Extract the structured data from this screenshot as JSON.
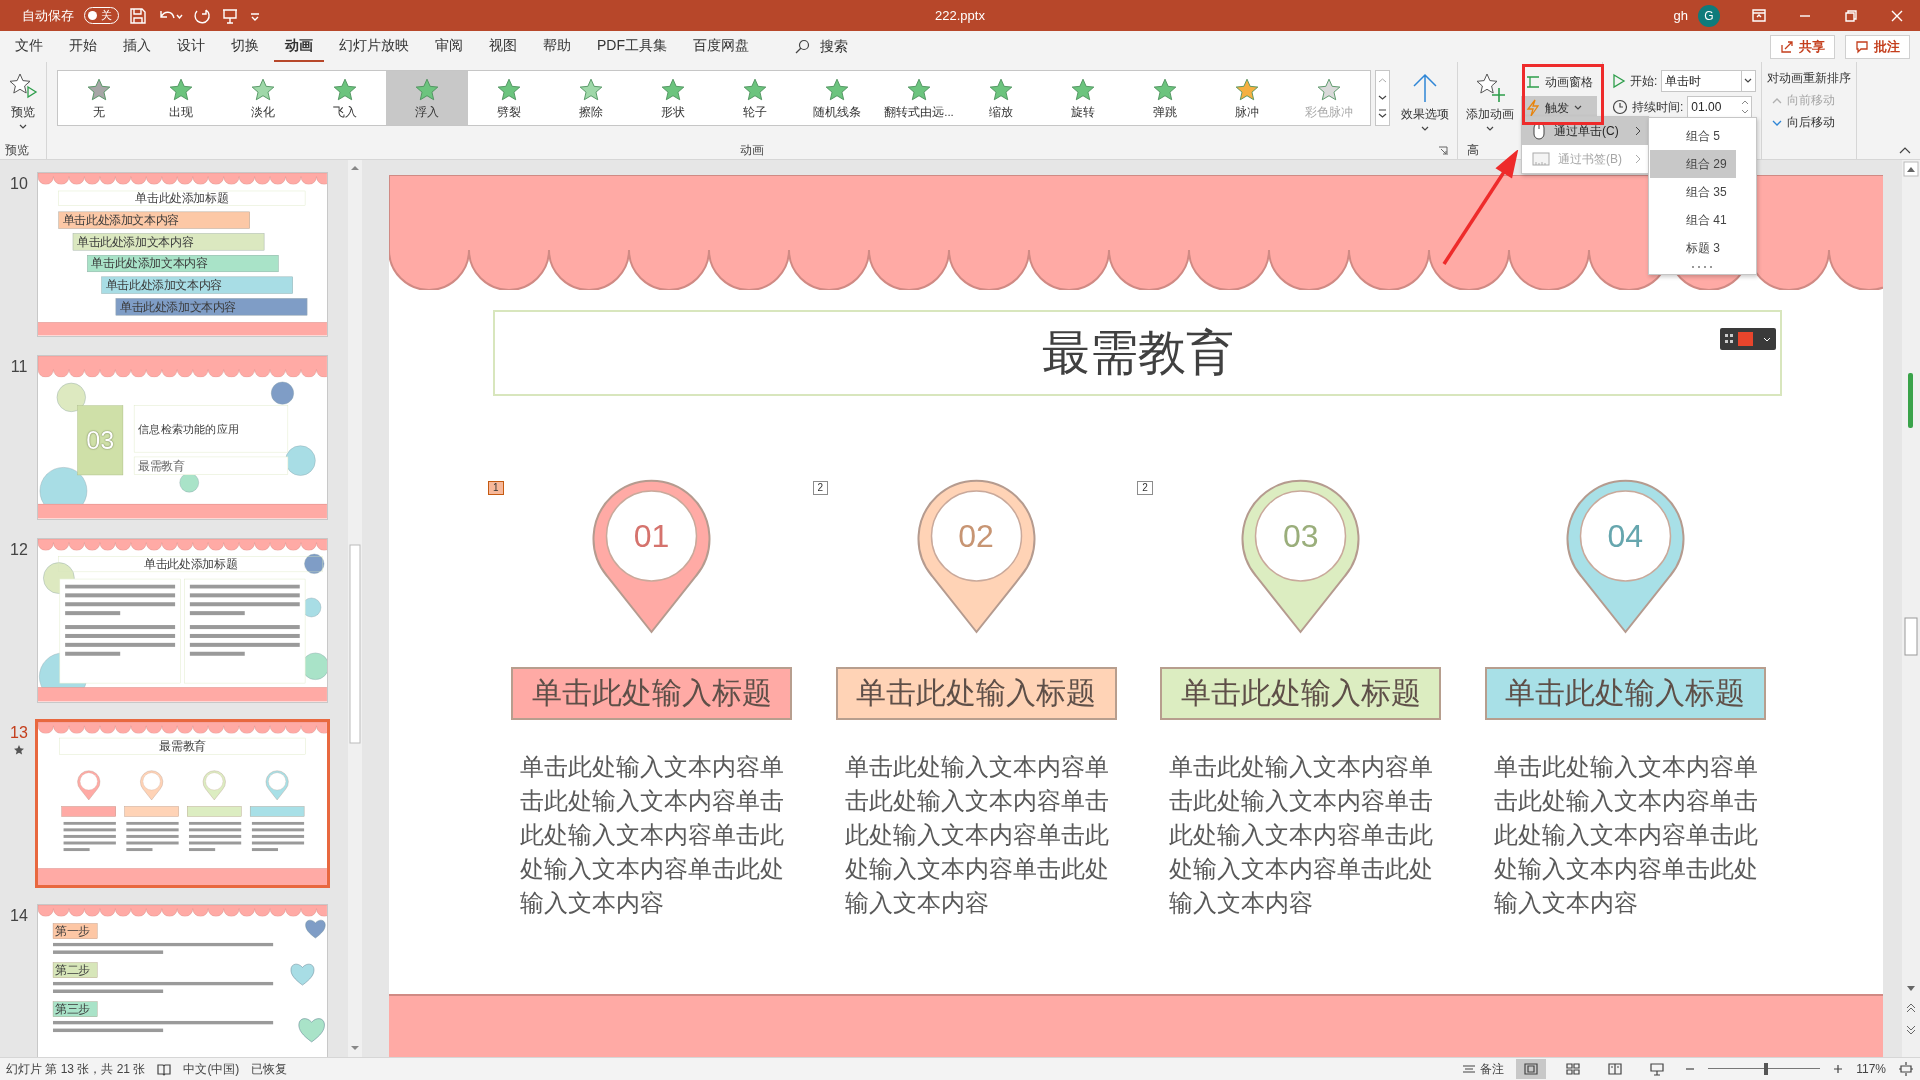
{
  "title_bar": {
    "autosave_label": "自动保存",
    "autosave_on": false,
    "autosave_state": "关",
    "file_name": "222.pptx",
    "user": "gh",
    "avatar": "G"
  },
  "menu_tabs": [
    {
      "label": "文件",
      "selected": false
    },
    {
      "label": "开始",
      "selected": false
    },
    {
      "label": "插入",
      "selected": false
    },
    {
      "label": "设计",
      "selected": false
    },
    {
      "label": "切换",
      "selected": false
    },
    {
      "label": "动画",
      "selected": true
    },
    {
      "label": "幻灯片放映",
      "selected": false
    },
    {
      "label": "审阅",
      "selected": false
    },
    {
      "label": "视图",
      "selected": false
    },
    {
      "label": "帮助",
      "selected": false
    },
    {
      "label": "PDF工具集",
      "selected": false
    },
    {
      "label": "百度网盘",
      "selected": false
    }
  ],
  "search_label": "搜索",
  "share": "共享",
  "comments": "批注",
  "ribbon": {
    "preview": "预览",
    "preview_group": "预览",
    "gallery": [
      {
        "label": "无",
        "selected": false,
        "disabled": false,
        "color": "#a6a6a6"
      },
      {
        "label": "出现",
        "selected": false,
        "disabled": false,
        "color": "#6cc47e"
      },
      {
        "label": "淡化",
        "selected": false,
        "disabled": false,
        "color": "#9fd8a9"
      },
      {
        "label": "飞入",
        "selected": false,
        "disabled": false,
        "color": "#6cc47e"
      },
      {
        "label": "浮入",
        "selected": true,
        "disabled": false,
        "color": "#6cc47e"
      },
      {
        "label": "劈裂",
        "selected": false,
        "disabled": false,
        "color": "#6cc47e"
      },
      {
        "label": "擦除",
        "selected": false,
        "disabled": false,
        "color": "#9fd8a9"
      },
      {
        "label": "形状",
        "selected": false,
        "disabled": false,
        "color": "#6cc47e"
      },
      {
        "label": "轮子",
        "selected": false,
        "disabled": false,
        "color": "#6cc47e"
      },
      {
        "label": "随机线条",
        "selected": false,
        "disabled": false,
        "color": "#6cc47e"
      },
      {
        "label": "翻转式由远...",
        "selected": false,
        "disabled": false,
        "color": "#6cc47e"
      },
      {
        "label": "缩放",
        "selected": false,
        "disabled": false,
        "color": "#6cc47e"
      },
      {
        "label": "旋转",
        "selected": false,
        "disabled": false,
        "color": "#6cc47e"
      },
      {
        "label": "弹跳",
        "selected": false,
        "disabled": false,
        "color": "#6cc47e"
      },
      {
        "label": "脉冲",
        "selected": false,
        "disabled": false,
        "color": "#f5b041"
      },
      {
        "label": "彩色脉冲",
        "selected": false,
        "disabled": true,
        "color": "#d9d9d9"
      }
    ],
    "effect_options": "效果选项",
    "gallery_group": "动画",
    "add_animation": "添加动画",
    "animation_pane": "动画窗格",
    "trigger": "触发",
    "advanced_group": "高",
    "start_label": "开始:",
    "start_value": "单击时",
    "duration_label": "持续时间:",
    "duration_value": "01.00",
    "reorder_title": "对动画重新排序",
    "move_earlier": {
      "label": "向前移动",
      "disabled": true
    },
    "move_later": {
      "label": "向后移动",
      "disabled": false
    }
  },
  "trigger_menu": {
    "items": [
      {
        "kind": "click",
        "label": "通过单击(C)",
        "selected": true,
        "disabled": false
      },
      {
        "kind": "bookmark",
        "label": "通过书签(B)",
        "selected": false,
        "disabled": true
      }
    ],
    "submenu": [
      {
        "label": "组合 5",
        "selected": false
      },
      {
        "label": "组合 29",
        "selected": true
      },
      {
        "label": "组合 35",
        "selected": false
      },
      {
        "label": "组合 41",
        "selected": false
      },
      {
        "label": "标题 3",
        "selected": false
      }
    ]
  },
  "thumbnails": [
    {
      "number": "10",
      "selected": false,
      "has_animation": false,
      "kind": "steps",
      "title": "单击此处添加标题",
      "items": [
        {
          "text": "单击此处添加文本内容",
          "color": "#fcc8a6"
        },
        {
          "text": "单击此处添加文本内容",
          "color": "#dbe8c0"
        },
        {
          "text": "单击此处添加文本内容",
          "color": "#a9e3c8"
        },
        {
          "text": "单击此处添加文本内容",
          "color": "#a8dde5"
        },
        {
          "text": "单击此处添加文本内容",
          "color": "#7f9dc6"
        }
      ]
    },
    {
      "number": "11",
      "selected": false,
      "has_animation": false,
      "kind": "section",
      "section_number": "03",
      "title": "信息检索功能的应用",
      "subtitle": "最需教育"
    },
    {
      "number": "12",
      "selected": false,
      "has_animation": false,
      "kind": "columns",
      "title": "单击此处添加标题"
    },
    {
      "number": "13",
      "selected": true,
      "has_animation": true,
      "kind": "cards",
      "title": "最需教育",
      "cards": [
        {
          "color": "#ffaaa5"
        },
        {
          "color": "#ffd3b6"
        },
        {
          "color": "#dcedc1"
        },
        {
          "color": "#a8e0e7"
        }
      ]
    },
    {
      "number": "14",
      "selected": false,
      "has_animation": false,
      "kind": "list",
      "steps": [
        {
          "label": "第一步",
          "color": "#fdc7a5"
        },
        {
          "label": "第二步",
          "color": "#d7e6b9"
        },
        {
          "label": "第三步",
          "color": "#a9e3c8"
        }
      ]
    }
  ],
  "slide": {
    "title": "最需教育",
    "cards": [
      {
        "number": "01",
        "heading": "单击此处输入标题",
        "body": "单击此处输入文本内容单击此处输入文本内容单击此处输入文本内容单击此处输入文本内容单击此处输入文本内容",
        "color": "#ffaaa5",
        "animation_marker": {
          "label": "1",
          "selected": true
        }
      },
      {
        "number": "02",
        "heading": "单击此处输入标题",
        "body": "单击此处输入文本内容单击此处输入文本内容单击此处输入文本内容单击此处输入文本内容单击此处输入文本内容",
        "color": "#ffd3b6",
        "animation_marker": {
          "label": "2",
          "selected": false
        }
      },
      {
        "number": "03",
        "heading": "单击此处输入标题",
        "body": "单击此处输入文本内容单击此处输入文本内容单击此处输入文本内容单击此处输入文本内容单击此处输入文本内容",
        "color": "#dcedc1",
        "animation_marker": {
          "label": "2",
          "selected": false
        }
      },
      {
        "number": "04",
        "heading": "单击此处输入标题",
        "body": "单击此处输入文本内容单击此处输入文本内容单击此处输入文本内容单击此处输入文本内容单击此处输入文本内容",
        "color": "#a8e0e7"
      }
    ]
  },
  "status_bar": {
    "slide_counter": "幻灯片 第 13 张，共 21 张",
    "language": "中文(中国)",
    "recovery": "已恢复",
    "notes": "备注",
    "views": [
      {
        "kind": "normal",
        "selected": true
      },
      {
        "kind": "sorter",
        "selected": false
      },
      {
        "kind": "reading",
        "selected": false
      },
      {
        "kind": "show",
        "selected": false
      }
    ],
    "zoom": {
      "level": 0.52
    },
    "zoom_percent": "117%"
  }
}
